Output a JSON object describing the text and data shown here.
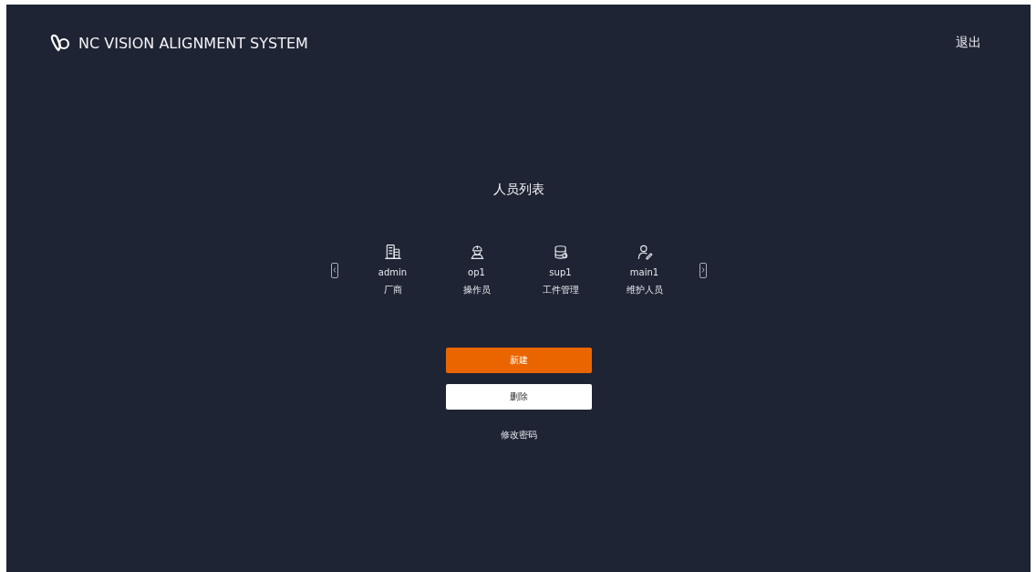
{
  "header": {
    "title": "NC VISION ALIGNMENT SYSTEM",
    "logout": "退出"
  },
  "user_list": {
    "title": "人员列表",
    "users": [
      {
        "name": "admin",
        "role": "厂商",
        "kind": "building"
      },
      {
        "name": "op1",
        "role": "操作员",
        "kind": "worker"
      },
      {
        "name": "sup1",
        "role": "工件管理",
        "kind": "database"
      },
      {
        "name": "main1",
        "role": "维护人员",
        "kind": "editor"
      }
    ]
  },
  "buttons": [
    {
      "label": "新建",
      "kind": "primary"
    },
    {
      "label": "删除",
      "kind": "secondary"
    }
  ],
  "change_password": "修改密码"
}
